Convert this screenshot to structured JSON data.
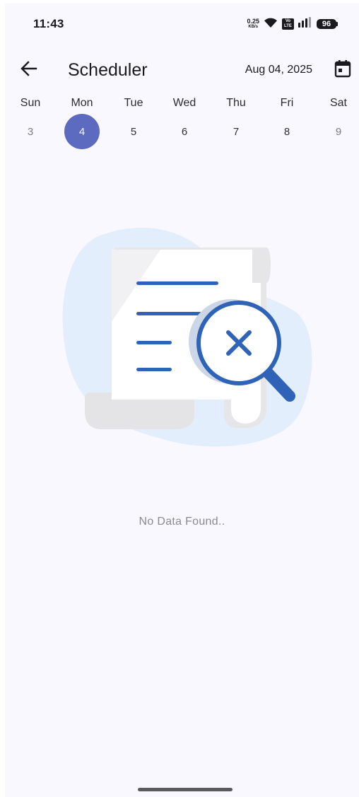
{
  "status_bar": {
    "time": "11:43",
    "net_speed_value": "0.25",
    "net_speed_unit": "KB/s",
    "volte_top": "Vo",
    "volte_bottom": "LTE",
    "battery": "96"
  },
  "app_bar": {
    "title": "Scheduler",
    "date": "Aug 04, 2025",
    "back_icon": "arrow-left-icon",
    "calendar_icon": "calendar-icon"
  },
  "week": {
    "days": [
      {
        "name": "Sun",
        "num": "3"
      },
      {
        "name": "Mon",
        "num": "4"
      },
      {
        "name": "Tue",
        "num": "5"
      },
      {
        "name": "Wed",
        "num": "6"
      },
      {
        "name": "Thu",
        "num": "7"
      },
      {
        "name": "Fri",
        "num": "8"
      },
      {
        "name": "Sat",
        "num": "9"
      }
    ]
  },
  "empty_state": {
    "message": "No Data Found..",
    "icon": "no-results-document-icon"
  },
  "colors": {
    "accent": "#5c6bc0",
    "illustration_blue": "#2f63b8",
    "blob": "#e3eefc",
    "background": "#f9f8fe"
  }
}
